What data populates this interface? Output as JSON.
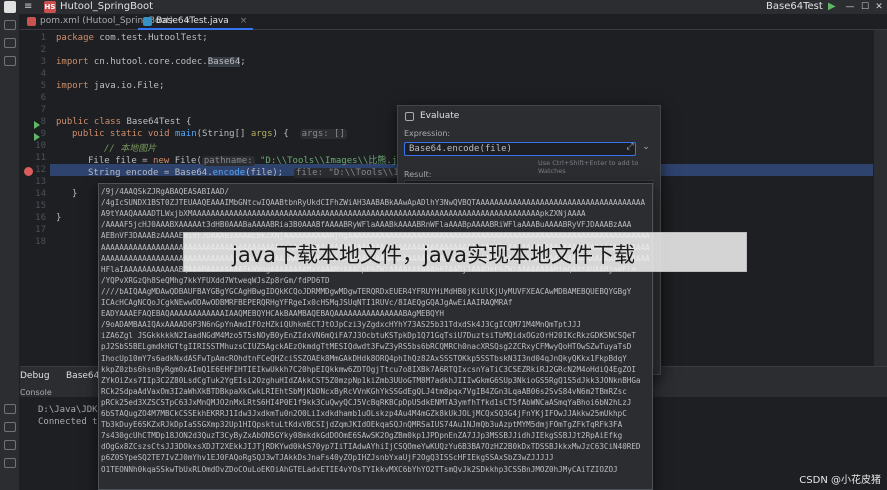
{
  "title_bar": {
    "menu_glyph": "≡",
    "project_badge": "HS",
    "project_name": "Hutool_SpringBoot",
    "run_config": "Base64Test",
    "run_glyph": "▶",
    "minimize": "—",
    "maximize": "☐",
    "close": "✕"
  },
  "tabs": [
    {
      "label": "pom.xml (Hutool_SpringBoot)",
      "icon_color": "#c75450",
      "active": false,
      "close": "×"
    },
    {
      "label": "Base64Test.java",
      "icon_color": "#3592c4",
      "active": true,
      "close": "×"
    }
  ],
  "editor": {
    "line_numbers": [
      "1",
      "2",
      "3",
      "4",
      "5",
      "6",
      "7",
      "8",
      "9",
      "10",
      "11",
      "12",
      "13",
      "14",
      "15",
      "16",
      "17",
      "18"
    ],
    "lines": {
      "l1_kw": "package",
      "l1_rest": " com.test.HutoolTest;",
      "l3_kw": "import",
      "l3_rest": " cn.hutool.core.codec.",
      "l3_cls": "Base64",
      "l3_end": ";",
      "l5_kw": "import",
      "l5_rest": " java.io.File;",
      "l8_kw1": "public class",
      "l8_rest": " Base64Test {",
      "l9_kw": "public static void",
      "l9_fn": " main",
      "l9_rest": "(String[] ",
      "l9_arg": "args",
      "l9_end": ") {",
      "l9_hint": "args: []",
      "l10_cmt": "// 本地图片",
      "l11_rest1": "File file = ",
      "l11_kw": "new",
      "l11_rest2": " File(",
      "l11_hint": "pathname:",
      "l11_str": "\"D:\\\\Tools\\\\Images\\\\比熊.jpg\"",
      "l11_end": ");",
      "l12_rest1": "String encode = Base64.",
      "l12_fn": "encode",
      "l12_rest2": "(file);",
      "l12_hint": "file: \"D:\\\\Tools\\\\Images\\\\比熊犬\"",
      "l14_brace": "}",
      "l15_brace": "}"
    }
  },
  "evaluate": {
    "title": "Evaluate",
    "expression_label": "Expression:",
    "expression_value": "Base64.encode(file)",
    "expand_glyph": "⤢",
    "history_glyph": "⌄",
    "shortcut_hint": "Use Ctrl+Shift+Enter to add to Watches",
    "result_label": "Result:"
  },
  "popup_lines": [
    "/9j/4AAQSkZJRgABAQEASABIAAD/",
    "/4gIcSUNDX1BST0ZJTEUAAQEAAAIMbGNtcwIQAABtbnRyUkdCIFhZWiAH3AABABkAAwApADlhY3NwQVBQTAAAAAAAAAAAAAAAAAAAAAAAAAAAAAAAAAAAAA",
    "A9tYAAQAAAADTLWxjbXMAAAAAAAAAAAAAAAAAAAAAAAAAAAAAAAAAAAAAAAAAAAAAAAAAAAAAAAAAAAAAAAAAAAAAAAAAAAApkZXNjAAAA",
    "/AAAAF5jcHJ0AAABXAAAAAt3dHB0AAABaAAAABRia3B0AAABfAAAABRyWFlaAAABkAAAABRnWFlaAAABpAAAABRiWFlaAAABuAAAABRyVFJDAAABzAAA",
    "AEBnVF3DAAABzAAAAEBiVFJDAAABzAAAAEBkZXNjAAAAAAAAAANjMgAAAAAAAAAAAAAAAAAAAAAAAAAAAAAAAAAAAAAAAAAAAAAAAAAAAAAAAAAAAAAAAAAA",
    "AAAAAAAAAAAAAAAAAAAAAAAAAAAAAAAAAAAAAAAAAAAAAAAAAAAAAAAAAAAAAAAAAAAAAAAAAAAAAAAAAAAAAAAAAAAAAAAAAAAAAAAAAAAAAAAAAAAAAAAA",
    "AAAAAAAAAAAAAAAAAAAAAAAAAAAAAAAAAAAAAAAAAAAAAAAAAAAAAAAAAAAAAAAAAAAAAAAAAAAAAAAAAAAAAAAAAAAAAAAAAAAAAAAAAAAAAAAAAAAAAAAA",
    "HFlaIAAAAAAAAAAAABQAAABAAAAAAAAFkWVogAAAAAAAAMxYAAAMzAAACpFhZWiAAAAAAAAAAb6IAADj1AAADkFhZWiAAAAAAAABimQAAt4UAABjaWFla",
    "/YQPvXRGzQh8SeQMhg7kkYFUXdd7WtweqWJsZp8rGm/fdPD6TD",
    "////bAIQAAgMDAwQDBAUFBAYGBgYGCAgHBwgIDQkKCQoJDRMMDgwMDgwTERQRDxEUER4YFRUYHiMdHB0jKiUlKjUyMUVFXEACAwMDBAMEBQUEBQYGBgY",
    "ICAcHCAgNCQoJCgkNEwwODAwODBMRFBEPERQRHgYFRgeIx0cHSMqJSUqNTI1RUVc/8IAEQgGQAJgAwEiAAIRAQMRAf",
    "EADYAAAEFAQEBAQAAAAAAAAAAAAIAAQMEBQYHCAkBAAMBAQEBAQAAAAAAAAAAAAAAABAgMEBQYH",
    "/9oADAMBAAIQAxAAAAD6P3N6nGpYnAmdIFOzHZkiQUhkmECTJtOJpCzi3yZgdxcHYhY73AS25b31TdxdSk4J3CgICQM71M4MnQmTptJJJ",
    "iZA6Zgl JSGkkkkkN2IaadNGdM4Mzo5T5sNOyB0yEnZIdxVN6mQiFA7J3OcbtuKSTpkDp1Q71GqTsiU7DuztsiTbMQidxOGzOrH20IKcRkzGDK5NCSQeT",
    "pJ2SbS5BELgmdkHGTtgIIRISSTMhuzsCIUZ5AgckAEzOkmdgTtMESIQdwdt3FwZ3yRS5bs6bRCQMRCh0nacXRSQsg2ZCRxyCFMwyQoHTOwSZwTuyaTsD",
    "IhocUp10mY7s6adkNxdASFwTpAmcROhdtnFCeQHZciSSZOAEk8MmGAkDHdk8ORQ4phIhQz82AxSSSTOKkp5SSTbskN3I3nd04qJnQkyQKkx1FkpBdqY",
    "kkpZ0zbs6hsnByRgm0xAImQ1E6EHFIHTIEIkwUkkh7C20hpEIQkkmw6ZDTOgjTtcu7o8IXBk7A6RTQIxcsnYaTiC3CSEZRkiRJ2GRcN2M4oHdiQ4EgZOI",
    "ZYkOiZxs7IIp3C2Z80LsdCgTuk2YgEIsi2OzghuHIdZAkkCST5Z0mzpNp1kiZmb3UUoGTM8M7adkhJIIIwGkmG6SUp3NkioGS5RgQ1S5dJkk3JONknBHGa",
    "RCk2SdpaAdVaxOm3I2aWhXkBTDBkpaXkCwkLRIEhtSbMjKbDNcxByRcVVnKGhYkSSGdEgQLJ4tm8pqx7VgIB4ZGn3LqaAB06s2SvS84vN6m2TBmRZsc",
    "pRCk25ed3XZSCSTpC63JxMnQMJO2nMxLRtS6HI4P0E1f9kk3CuQwyQCJ5VcBqRKBCpDpU5dkENMTA3ymfhTfkd1sCT5fAbWNCaASmqYaBhoi6bN2hLzJ",
    "6bSTAQugZO4M7MBCkCSSEkhEKRRJ1Idw3JxdkmTu0n2O0LiIxdkdhamb1uOLskzp4Au4M4mGZk8kUkJOLjMCQxSQ3G4jFnYKjIFOwJJAkkw25mUkhpC",
    "Tb3kDuyE6SKZxRJkDpIaSSGXmp32Up1HIQpsktuLtKdxVBCSIjdZqmJKIdOEkqaSQJnQMRSaIUS74Au1NJmQb3uAzptMYM5dmjFOmTgZFkTqRFk3FA",
    "7s430gcUhCTMDp18JON2d3QuzT3CyByZxAbON5GYky08mkdkGdDOOmE6SAwSK2OgZBm0kp1JPDpnEnZA7JJp3MSSBJJidhJIEkgSSBJJt2RpAiEfkg",
    "dOgGx8ZCszsCtsJJ3DOkxsXDJT2XEkkJIJTjRDKYwd0kkS70yp7IiTIAdwAYhiIjCSQOmeYwKUQzYu6B3BA7OzHZ2B0kDxTDSSBJkkxMwJzC63CiN40RED",
    "p6Z0SYpeSQ2TE7IvZJ0mYhv1EJ0FAQoRgSQJ3wTJAkkDsJnaFs40yZOpIHZJsnbYxaUjF2OgQ3ISScHFIEkgSSAxSbZ3wZJJJJJ",
    "O1TEONNh0kqaSSkwTbUxRLOmdOvZDoCOuLoEKOiAhGTELadxETIE4vYOsTYIkkvMXC6bYhYO2TTsmQvJk2SDkkhp3CSSBnJMOZ0hJMyCAiTZIOZOJ"
  ],
  "debug": {
    "tab_debug": "Debug",
    "tab_session": "Base64T...",
    "sub_console": "Console",
    "console_lines": [
      "D:\\Java\\JDK\\",
      "Connected to"
    ]
  },
  "banner_text": "java下载本地文件，java实现本地文件下载",
  "credit": "CSDN @小花皮猪",
  "colors": {
    "accent": "#3574f0",
    "breakpoint": "#db5c5c",
    "run": "#5fb865"
  }
}
